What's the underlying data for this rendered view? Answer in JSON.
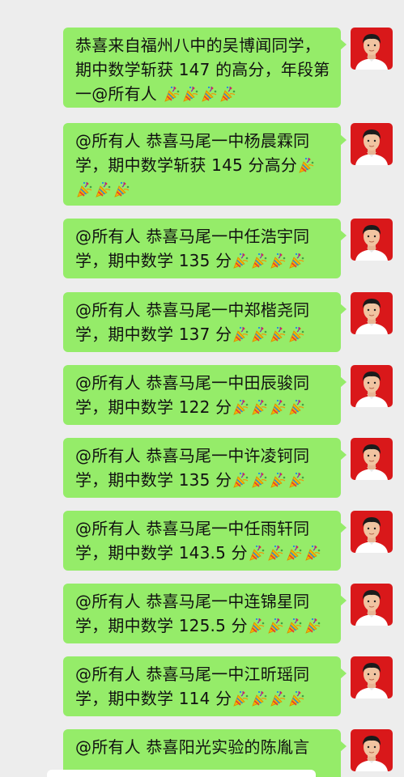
{
  "colors": {
    "background": "#ededed",
    "bubble": "#95ec69",
    "avatar_bg": "#d9181a"
  },
  "emoji_name": "party-popper-emoji",
  "messages": [
    {
      "lines": [
        "恭喜来自福州八中的吴博闻同学，期中数学斩获 147 的高分，年段第一@所有人 "
      ],
      "emoji_count": 4
    },
    {
      "lines": [
        "@所有人  恭喜马尾一中杨晨霖同学，期中数学斩获 145 分高分"
      ],
      "emoji_count": 4
    },
    {
      "lines": [
        "@所有人  恭喜马尾一中任浩宇同学，期中数学 135 分"
      ],
      "emoji_count": 4
    },
    {
      "lines": [
        "@所有人  恭喜马尾一中郑楷尧同学，期中数学 137 分"
      ],
      "emoji_count": 4
    },
    {
      "lines": [
        "@所有人  恭喜马尾一中田辰骏同学，期中数学 122 分"
      ],
      "emoji_count": 4
    },
    {
      "lines": [
        "@所有人  恭喜马尾一中许凌钶同学，期中数学 135 分"
      ],
      "emoji_count": 4
    },
    {
      "lines": [
        "@所有人  恭喜马尾一中任雨轩同学，期中数学 143.5 分"
      ],
      "emoji_count": 4
    },
    {
      "lines": [
        "@所有人  恭喜马尾一中连锦星同学，期中数学 125.5 分"
      ],
      "emoji_count": 4
    },
    {
      "lines": [
        "@所有人  恭喜马尾一中江昕瑶同学，期中数学 114 分"
      ],
      "emoji_count": 4
    },
    {
      "lines": [
        "@所有人  恭喜阳光实验的陈胤言"
      ],
      "emoji_count": 0
    }
  ]
}
